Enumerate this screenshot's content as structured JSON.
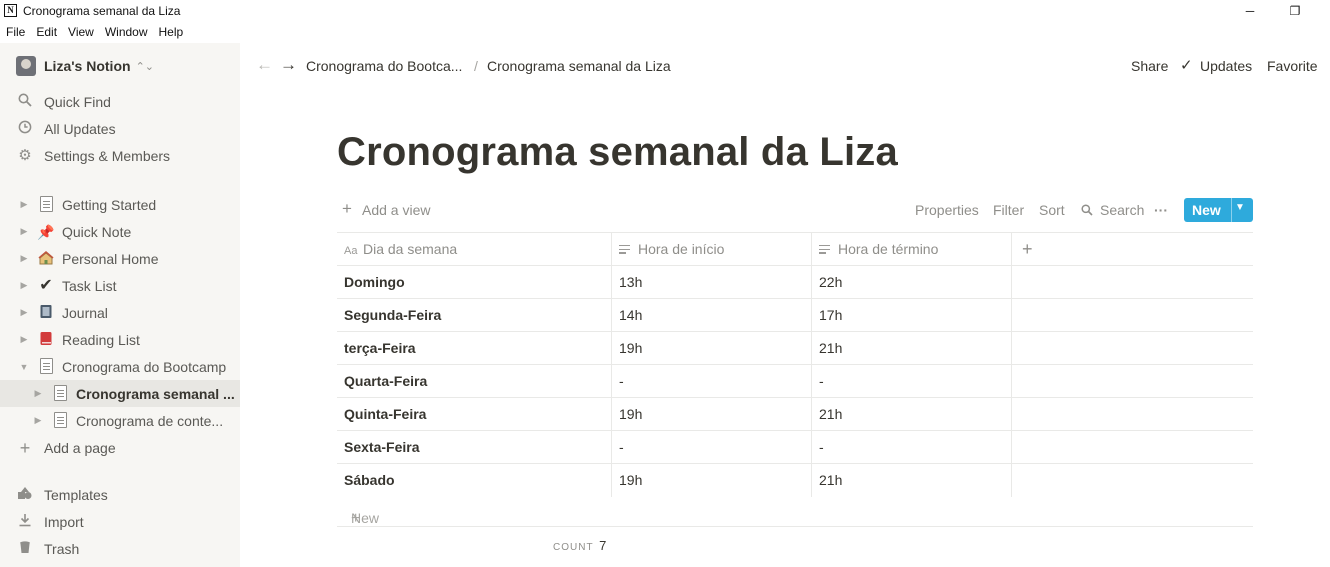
{
  "window": {
    "title": "Cronograma semanal da Liza",
    "app_icon": "N",
    "minimize": "─",
    "restore": "❐"
  },
  "menu": [
    "File",
    "Edit",
    "View",
    "Window",
    "Help"
  ],
  "sidebar": {
    "workspace": "Liza's Notion",
    "top_items": [
      {
        "label": "Quick Find",
        "icon": "search-icon"
      },
      {
        "label": "All Updates",
        "icon": "clock-icon"
      },
      {
        "label": "Settings & Members",
        "icon": "gear-icon"
      }
    ],
    "pages": [
      {
        "label": "Getting Started",
        "icon": "page-icon"
      },
      {
        "label": "Quick Note",
        "icon": "pushpin-icon"
      },
      {
        "label": "Personal Home",
        "icon": "house-icon"
      },
      {
        "label": "Task List",
        "icon": "checkmark-icon"
      },
      {
        "label": "Journal",
        "icon": "notebook-icon"
      },
      {
        "label": "Reading List",
        "icon": "book-icon"
      },
      {
        "label": "Cronograma do Bootcamp",
        "icon": "page-icon",
        "expanded": true
      },
      {
        "label": "Cronograma semanal ...",
        "icon": "page-icon",
        "active": true
      },
      {
        "label": "Cronograma de conte...",
        "icon": "page-icon"
      }
    ],
    "add_page": "Add a page",
    "bottom_items": [
      {
        "label": "Templates",
        "icon": "shapes-icon"
      },
      {
        "label": "Import",
        "icon": "download-icon"
      },
      {
        "label": "Trash",
        "icon": "trash-icon"
      }
    ]
  },
  "topbar": {
    "breadcrumb": [
      "Cronograma do Bootca...",
      "/",
      "Cronograma semanal da Liza"
    ],
    "share": "Share",
    "updates": "Updates",
    "favorite": "Favorite"
  },
  "page": {
    "title": "Cronograma semanal da Liza",
    "add_view": "Add a view",
    "toolbar": {
      "properties": "Properties",
      "filter": "Filter",
      "sort": "Sort",
      "search": "Search",
      "more": "···",
      "new": "New"
    },
    "table": {
      "columns": [
        {
          "label": "Dia da semana",
          "icon": "Aa"
        },
        {
          "label": "Hora de início",
          "icon": "text-icon"
        },
        {
          "label": "Hora de término",
          "icon": "text-icon"
        }
      ],
      "add_column": "+",
      "rows": [
        [
          "Domingo",
          "13h",
          "22h"
        ],
        [
          "Segunda-Feira",
          "14h",
          "17h"
        ],
        [
          "terça-Feira",
          "19h",
          "21h"
        ],
        [
          "Quarta-Feira",
          "-",
          "-"
        ],
        [
          "Quinta-Feira",
          "19h",
          "21h"
        ],
        [
          "Sexta-Feira",
          "-",
          "-"
        ],
        [
          "Sábado",
          "19h",
          "21h"
        ]
      ],
      "new_row": "New",
      "count_label": "COUNT",
      "count_value": "7"
    }
  }
}
